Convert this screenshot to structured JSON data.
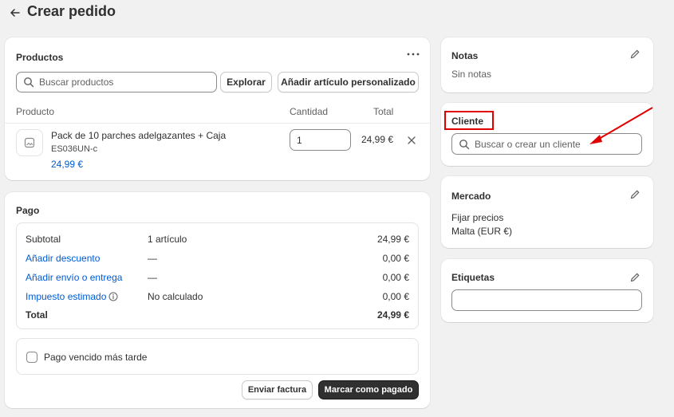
{
  "header": {
    "title": "Crear pedido"
  },
  "products": {
    "title": "Productos",
    "search_placeholder": "Buscar productos",
    "browse_label": "Explorar",
    "custom_item_label": "Añadir artículo personalizado",
    "columns": {
      "product": "Producto",
      "quantity": "Cantidad",
      "total": "Total"
    },
    "item": {
      "name": "Pack de 10 parches adelgazantes + Caja",
      "sku": "ES036UN-c",
      "price": "24,99 €",
      "quantity": "1",
      "total": "24,99 €"
    }
  },
  "payment": {
    "title": "Pago",
    "rows": [
      {
        "label": "Subtotal",
        "detail": "1 artículo",
        "value": "24,99 €"
      },
      {
        "label": "Añadir descuento",
        "detail": "—",
        "value": "0,00 €"
      },
      {
        "label": "Añadir envío o entrega",
        "detail": "—",
        "value": "0,00 €"
      },
      {
        "label": "Impuesto estimado",
        "detail": "No calculado",
        "value": "0,00 €"
      },
      {
        "label": "Total",
        "detail": "",
        "value": "24,99 €"
      }
    ],
    "pay_later_label": "Pago vencido más tarde",
    "send_invoice_label": "Enviar factura",
    "mark_paid_label": "Marcar como pagado"
  },
  "notes": {
    "title": "Notas",
    "value": "Sin notas"
  },
  "customer": {
    "title": "Cliente",
    "search_placeholder": "Buscar o crear un cliente"
  },
  "market": {
    "title": "Mercado",
    "line1": "Fijar precios",
    "line2": "Malta (EUR €)"
  },
  "tags": {
    "title": "Etiquetas",
    "value": ""
  },
  "colors": {
    "accent": "#005bd3",
    "annotation": "#e00000",
    "dark_button": "#303030"
  }
}
